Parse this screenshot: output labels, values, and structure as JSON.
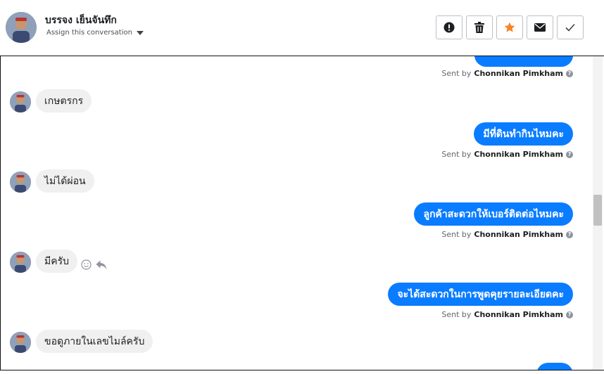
{
  "header": {
    "contact_name": "บรรจง เย็นจันทึก",
    "assign_label": "Assign this conversation",
    "avatar_icon": "user-avatar",
    "actions": [
      {
        "name": "mark-spam",
        "icon": "exclamation-circle-icon"
      },
      {
        "name": "delete",
        "icon": "trash-icon"
      },
      {
        "name": "star",
        "icon": "star-icon",
        "color": "#f5852a"
      },
      {
        "name": "mark-unread",
        "icon": "envelope-icon"
      },
      {
        "name": "mark-done",
        "icon": "checkmark-icon"
      }
    ]
  },
  "sent_by": {
    "prefix": "Sent by",
    "agent": "Chonnikan Pimkham"
  },
  "messages": [
    {
      "dir": "out",
      "text": "มีที่ดินทำกินไหมคะ"
    },
    {
      "dir": "out",
      "text": "ลูกค้าสะดวกให้เบอร์ติดต่อไหมคะ"
    },
    {
      "dir": "out",
      "text": "จะได้สะดวกในการพูดคุยรายละเอียดคะ"
    },
    {
      "dir": "in",
      "text": "เกษตรกร"
    },
    {
      "dir": "in",
      "text": "ไม่ได้ผ่อน"
    },
    {
      "dir": "in",
      "text": "มีครับ"
    },
    {
      "dir": "in",
      "text": "ขอดูภายในเลขไมล์ครับ"
    }
  ],
  "colors": {
    "outgoing_bubble": "#0a7cff",
    "incoming_bubble": "#f0f0f0",
    "star": "#f5852a"
  }
}
